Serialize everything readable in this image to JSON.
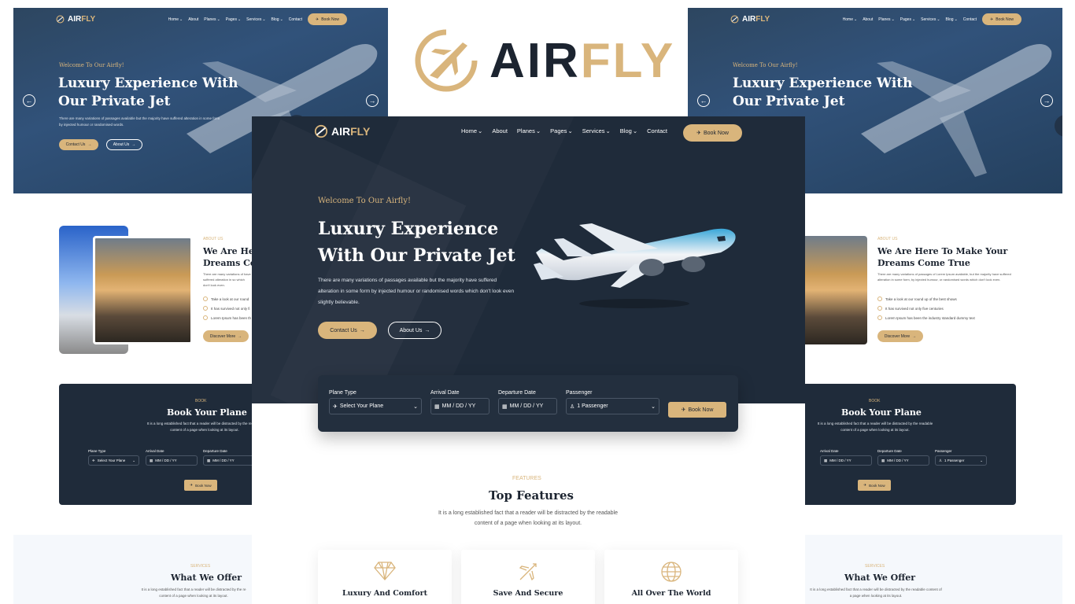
{
  "brand": {
    "name_left": "AIR",
    "name_right": "FLY"
  },
  "nav": {
    "items": [
      "Home",
      "About",
      "Planes",
      "Pages",
      "Services",
      "Blog",
      "Contact"
    ],
    "dropdown": [
      true,
      false,
      true,
      true,
      true,
      true,
      false
    ],
    "cta": "Book Now"
  },
  "hero": {
    "kicker": "Welcome To Our Airfly!",
    "title_line1": "Luxury Experience With",
    "title_line2": "Our Private Jet",
    "center_title_line1": "Luxury Experience",
    "center_title_line2": "With Our Private Jet",
    "body": "There are many variations of passages available but the majority have suffered alteration in some form by injected humour or randomised words which don't look even slightly believable.",
    "small_body": "There are many variations of passages available but the majority have suffered alteration in some form by injected humour or randomised words.",
    "contact_btn": "Contact Us",
    "about_btn": "About Us"
  },
  "booking": {
    "labels": {
      "plane": "Plane Type",
      "arrival": "Arrival Date",
      "departure": "Departure Date",
      "passenger": "Passenger"
    },
    "values": {
      "plane": "Select Your Plane",
      "arrival": "MM / DD / YY",
      "departure": "MM / DD / YY",
      "passenger": "1 Passenger"
    },
    "submit": "Book Now",
    "section_kicker": "BOOK",
    "section_title": "Book Your Plane",
    "section_body": "It is a long established fact that a reader will be distracted by the readable content of a page when looking at its layout."
  },
  "about": {
    "kicker": "ABOUT US",
    "title_left": "We Are Here",
    "title_left2": "Dreams Co",
    "title": "We Are Here To Make Your",
    "title2": "Dreams Come True",
    "body": "There are many variations of passages of Lorem Ipsum available, but the majority have suffered alteration in some form, by injected humour, or randomised words which don't look even.",
    "checks": [
      "Take a look at our round up of the best shows",
      "It has survived not only five centuries",
      "Lorem Ipsum has been the industry standard dummy text"
    ],
    "checks_left": [
      "Take a look at our round",
      "It has survived not only fi",
      "Lorem Ipsum has been th"
    ],
    "button": "Discover More"
  },
  "features": {
    "kicker": "FEATURES",
    "title": "Top Features",
    "body": "It is a long established fact that a reader will be distracted by the readable content of a page when looking at its layout.",
    "cards": [
      "Luxury And Comfort",
      "Save And Secure",
      "All Over The World"
    ]
  },
  "services": {
    "kicker": "SERVICES",
    "title": "What We Offer",
    "body": "It is a long established fact that a reader will be distracted by the readable content of a page when looking at its layout.",
    "body_left": "It is a long established fact that a reader will be distracted by the re"
  },
  "colors": {
    "navy": "#1f2b3a",
    "gold": "#d9b57c"
  }
}
